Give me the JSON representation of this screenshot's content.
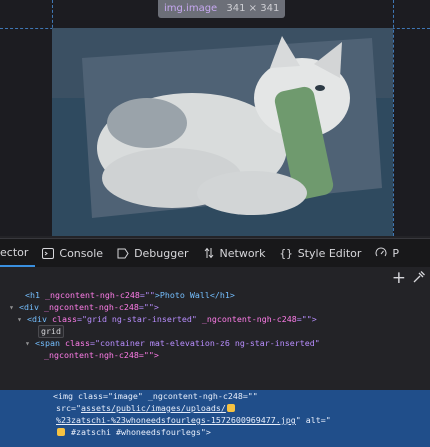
{
  "preview": {
    "tooltip_tag": "img",
    "tooltip_class": ".image",
    "tooltip_dims": "341 × 341"
  },
  "toolbar": {
    "partial_tab": "ector",
    "tabs": [
      {
        "label": "Console",
        "icon": "console-icon"
      },
      {
        "label": "Debugger",
        "icon": "debugger-icon"
      },
      {
        "label": "Network",
        "icon": "network-icon"
      },
      {
        "label": "Style Editor",
        "icon": "style-editor-icon"
      },
      {
        "label": "P",
        "icon": "performance-icon"
      }
    ]
  },
  "tree": {
    "line1_tag_open": "<h1 ",
    "line1_attr": "_ngcontent-ngh-c248",
    "line1_val": "=\"\"",
    "line1_text": ">Photo Wall</h1>",
    "line2_tag": "<div ",
    "line2_attr": "_ngcontent-ngh-c248",
    "line2_val": "=\"\">",
    "line3_tag": "<div ",
    "line3_attr": "class",
    "line3_val": "=\"grid ng-star-inserted\"",
    "line3_attr2": " _ngcontent-ngh-c248",
    "line3_val2": "=\"\">",
    "badge": "grid",
    "line4_tag": "<span ",
    "line4_attr": "class",
    "line4_val": "=\"container mat-elevation-z6 ng-star-inserted\"",
    "line5": "_ngcontent-ngh-c248=\"\">",
    "sel1": "<img class=\"image\" _ngcontent-ngh-c248=\"\"",
    "sel2_pre": "src=\"",
    "sel2_link": "assets/public/images/uploads/",
    "sel3": "%23zatschi-%23whoneedsfourlegs-1572600969477.jpg",
    "sel3_post": "\" alt=\"",
    "sel4": "#zatschi #whoneedsfourlegs\">"
  }
}
